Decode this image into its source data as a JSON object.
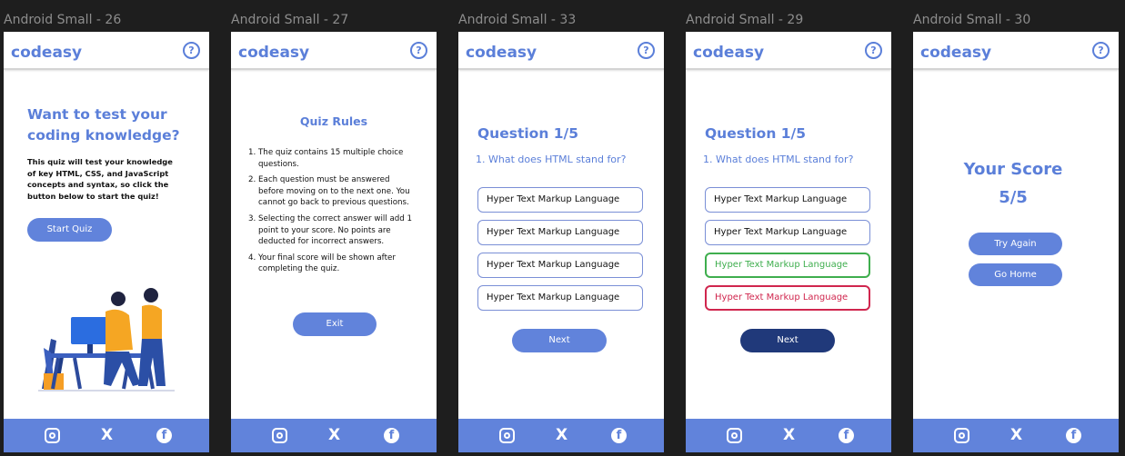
{
  "brand": "codeasy",
  "help_icon": "question-circle-icon",
  "footer_icons": [
    "instagram-icon",
    "x-twitter-icon",
    "facebook-icon"
  ],
  "footer_glyphs": {
    "x": "X",
    "fb": "f"
  },
  "colors": {
    "accent": "#5b7fd9",
    "footer": "#6183db",
    "correct": "#3fae4e",
    "wrong": "#d0264e",
    "next_active": "#20397a"
  },
  "frames": [
    {
      "title": "Android Small - 26"
    },
    {
      "title": "Android Small - 27"
    },
    {
      "title": "Android Small - 33"
    },
    {
      "title": "Android Small - 29"
    },
    {
      "title": "Android Small - 30"
    }
  ],
  "intro": {
    "heading": "Want to test your coding knowledge?",
    "description": "This quiz will test your knowledge of key HTML, CSS, and JavaScript concepts and syntax, so click the button below to start the quiz!",
    "start_button": "Start Quiz"
  },
  "rules": {
    "heading": "Quiz Rules",
    "items": [
      "The quiz contains 15 multiple choice questions.",
      "Each question must be answered before moving on to the next one. You cannot go back to previous questions.",
      "Selecting the correct answer will add 1 point to your score. No points are deducted for incorrect answers.",
      "Your final score will be shown after completing the quiz."
    ],
    "exit_button": "Exit"
  },
  "question": {
    "title": "Question 1/5",
    "text": "1. What does HTML stand for?",
    "options": [
      "Hyper Text Markup Language",
      "Hyper Text Markup Language",
      "Hyper Text Markup Language",
      "Hyper Text Markup Language"
    ],
    "next_button": "Next"
  },
  "result": {
    "heading": "Your Score",
    "score": "5/5",
    "try_again_button": "Try Again",
    "home_button": "Go Home"
  }
}
